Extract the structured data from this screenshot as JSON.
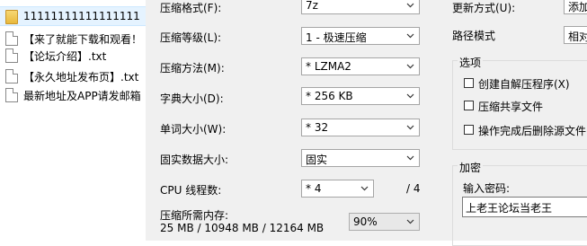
{
  "file_list": {
    "items": [
      {
        "name": "11111111111111111",
        "type": "folder"
      },
      {
        "name": "【来了就能下载和观看！",
        "type": "file"
      },
      {
        "name": "【论坛介绍】.txt",
        "type": "file"
      },
      {
        "name": "【永久地址发布页】.txt",
        "type": "file"
      },
      {
        "name": "最新地址及APP请发邮箱",
        "type": "file"
      }
    ]
  },
  "settings": {
    "archive_format": {
      "label": "压缩格式(F):",
      "value": "7z"
    },
    "compression_level": {
      "label": "压缩等级(L):",
      "value": "1 - 极速压缩"
    },
    "compression_method": {
      "label": "压缩方法(M):",
      "value": "* LZMA2"
    },
    "dictionary_size": {
      "label": "字典大小(D):",
      "value": "* 256 KB"
    },
    "word_size": {
      "label": "单词大小(W):",
      "value": "* 32"
    },
    "solid_block_size": {
      "label": "固实数据大小:",
      "value": "固实"
    },
    "cpu_threads": {
      "label": "CPU 线程数:",
      "value": "* 4",
      "total": "/ 4"
    },
    "memory_usage": {
      "label": "压缩所需内存:",
      "value": "25 MB / 10948 MB / 12164 MB",
      "percent": "90%"
    }
  },
  "right": {
    "update_mode": {
      "label": "更新方式(U):",
      "value": "添加"
    },
    "path_mode": {
      "label": "路径模式",
      "value": "相对"
    },
    "options": {
      "title": "选项",
      "items": [
        {
          "label": "创建自解压程序(X)",
          "checked": false
        },
        {
          "label": "压缩共享文件",
          "checked": false
        },
        {
          "label": "操作完成后删除源文件",
          "checked": false
        }
      ]
    },
    "encryption": {
      "title": "加密",
      "password_label": "输入密码:",
      "password_value": "上老王论坛当老王"
    }
  }
}
